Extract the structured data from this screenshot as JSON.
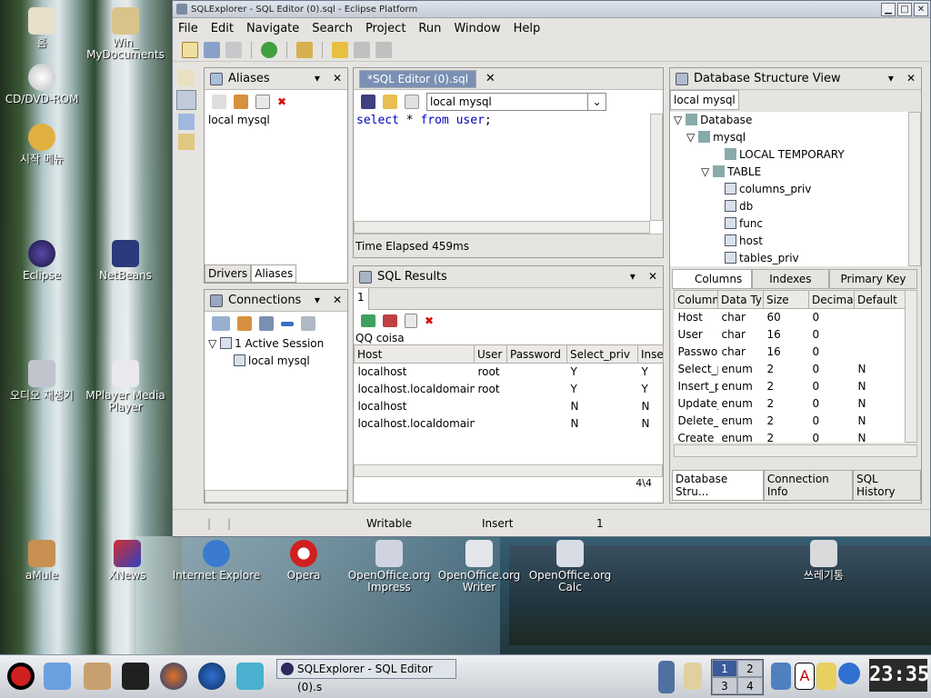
{
  "desktop": {
    "icons": [
      {
        "label": "홈"
      },
      {
        "label": "Win_\nMyDocuments"
      },
      {
        "label": "CD/DVD-ROM"
      },
      {
        "label": "시작 메뉴"
      },
      {
        "label": "Eclipse"
      },
      {
        "label": "NetBeans"
      },
      {
        "label": "오디오 재생기"
      },
      {
        "label": "MPlayer Media\nPlayer"
      },
      {
        "label": "aMule"
      },
      {
        "label": "XNews"
      },
      {
        "label": "Internet Explore"
      },
      {
        "label": "Opera"
      },
      {
        "label": "OpenOffice.org\nImpress"
      },
      {
        "label": "OpenOffice.org\nWriter"
      },
      {
        "label": "OpenOffice.org\nCalc"
      },
      {
        "label": "쓰레기통"
      }
    ]
  },
  "window": {
    "title": "SQLExplorer - SQL Editor (0).sql - Eclipse Platform",
    "controls": [
      "▁",
      "□",
      "✕"
    ]
  },
  "menu": [
    "File",
    "Edit",
    "Navigate",
    "Search",
    "Project",
    "Run",
    "Window",
    "Help"
  ],
  "aliases": {
    "title": "Aliases",
    "items": [
      "local mysql"
    ],
    "tabs": [
      "Drivers",
      "Aliases"
    ]
  },
  "connections": {
    "title": "Connections",
    "session": "1 Active Session",
    "connection": "local mysql"
  },
  "editor": {
    "tab": "*SQL Editor (0).sql",
    "alias_select": "local mysql",
    "sql_keyword1": "select",
    "sql_star": " * ",
    "sql_keyword2": "from",
    "sql_table": "user",
    "sql_end": ";",
    "status": "Time Elapsed 459ms"
  },
  "results": {
    "title": "SQL Results",
    "tab": "1",
    "query": "QQ coisa",
    "columns": [
      "Host",
      "User",
      "Password",
      "Select_priv",
      "Inser"
    ],
    "rows": [
      [
        "localhost",
        "root",
        "",
        "Y",
        "Y"
      ],
      [
        "localhost.localdomain",
        "root",
        "",
        "Y",
        "Y"
      ],
      [
        "localhost",
        "",
        "",
        "N",
        "N"
      ],
      [
        "localhost.localdomain",
        "",
        "",
        "N",
        "N"
      ]
    ],
    "count": "4\\4"
  },
  "dbstructure": {
    "title": "Database Structure View",
    "alias_tab": "local mysql",
    "tree": {
      "root": "Database",
      "schema": "mysql",
      "local_temp": "LOCAL TEMPORARY",
      "table_folder": "TABLE",
      "tables": [
        "columns_priv",
        "db",
        "func",
        "host",
        "tables_priv"
      ]
    },
    "detail_tabs": [
      "Columns",
      "Indexes",
      "Primary Key"
    ],
    "columns_header": [
      "Column",
      "Data Ty",
      "Size",
      "Decimal",
      "Default"
    ],
    "columns_rows": [
      [
        "Host",
        "char",
        "60",
        "0",
        ""
      ],
      [
        "User",
        "char",
        "16",
        "0",
        ""
      ],
      [
        "Passwo",
        "char",
        "16",
        "0",
        ""
      ],
      [
        "Select_p",
        "enum",
        "2",
        "0",
        "N"
      ],
      [
        "Insert_p",
        "enum",
        "2",
        "0",
        "N"
      ],
      [
        "Update_",
        "enum",
        "2",
        "0",
        "N"
      ],
      [
        "Delete_p",
        "enum",
        "2",
        "0",
        "N"
      ],
      [
        "Create_",
        "enum",
        "2",
        "0",
        "N"
      ]
    ],
    "bottom_tabs": [
      "Database Stru...",
      "Connection Info",
      "SQL History"
    ]
  },
  "statusbar": {
    "writable": "Writable",
    "mode": "Insert",
    "position": "1"
  },
  "taskbar": {
    "task": "SQLExplorer - SQL Editor (0).s",
    "pager": [
      "1",
      "2",
      "3",
      "4"
    ],
    "clock": "23:35",
    "tray_label": "A"
  }
}
